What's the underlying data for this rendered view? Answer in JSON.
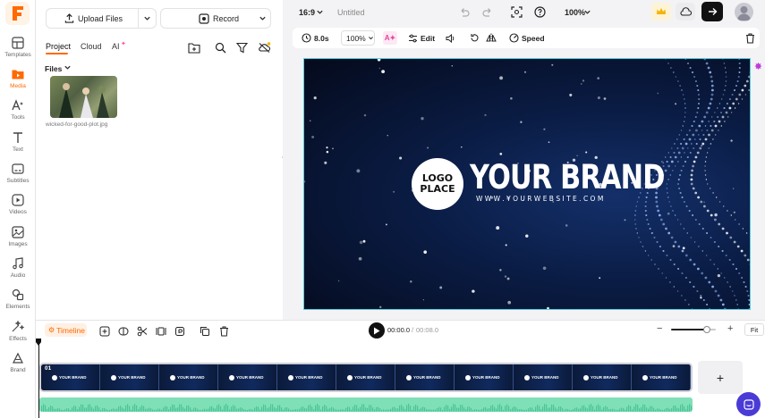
{
  "rail": {
    "items": [
      {
        "label": "Templates",
        "icon": "templates-icon"
      },
      {
        "label": "Media",
        "icon": "media-icon",
        "active": true
      },
      {
        "label": "Tools",
        "icon": "ai-tools-icon"
      },
      {
        "label": "Text",
        "icon": "text-icon"
      },
      {
        "label": "Subtitles",
        "icon": "subtitles-icon"
      },
      {
        "label": "Videos",
        "icon": "videos-icon"
      },
      {
        "label": "Images",
        "icon": "images-icon"
      },
      {
        "label": "Audio",
        "icon": "audio-icon"
      },
      {
        "label": "Elements",
        "icon": "elements-icon"
      },
      {
        "label": "Effects",
        "icon": "effects-icon"
      },
      {
        "label": "Brand",
        "icon": "brand-icon"
      }
    ]
  },
  "panel": {
    "upload_label": "Upload Files",
    "record_label": "Record",
    "tabs": [
      "Project",
      "Cloud",
      "AI"
    ],
    "files_label": "Files",
    "media_item": {
      "filename": "wicked-for-good-plot.jpg"
    }
  },
  "topbar": {
    "aspect": "16:9",
    "title": "Untitled",
    "zoom": "100%"
  },
  "toolbar": {
    "duration": "8.0s",
    "scale": "100%",
    "edit_label": "Edit",
    "speed_label": "Speed"
  },
  "canvas": {
    "logo_line1": "LOGO",
    "logo_line2": "PLACE",
    "brand": "YOUR BRAND",
    "website": "W W W . Y O U R W E B S I T E . C O M"
  },
  "timeline": {
    "label": "Timeline",
    "current_time": "00:00.0",
    "separator": "/",
    "total_time": "00:08.0",
    "fit_label": "Fit",
    "track_index": "01",
    "frame_text": "YOUR BRAND",
    "frame_count": 11,
    "zoom_level": 0.8
  },
  "colors": {
    "accent": "#ff6a00",
    "canvas_border": "#4fd0e0",
    "audio": "#7fe0b8",
    "premium": "#f4b400"
  }
}
